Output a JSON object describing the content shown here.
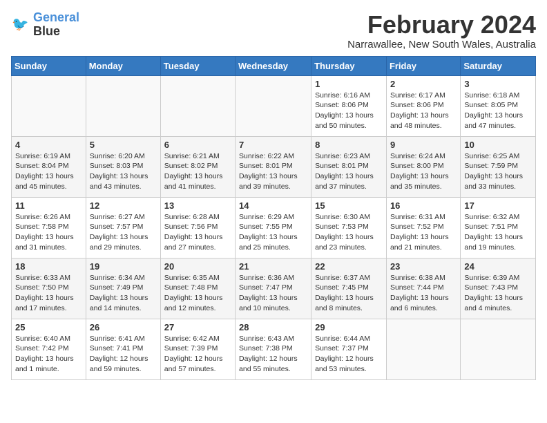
{
  "header": {
    "logo_line1": "General",
    "logo_line2": "Blue",
    "month_year": "February 2024",
    "location": "Narrawallee, New South Wales, Australia"
  },
  "days_of_week": [
    "Sunday",
    "Monday",
    "Tuesday",
    "Wednesday",
    "Thursday",
    "Friday",
    "Saturday"
  ],
  "weeks": [
    [
      {
        "day": "",
        "info": ""
      },
      {
        "day": "",
        "info": ""
      },
      {
        "day": "",
        "info": ""
      },
      {
        "day": "",
        "info": ""
      },
      {
        "day": "1",
        "info": "Sunrise: 6:16 AM\nSunset: 8:06 PM\nDaylight: 13 hours\nand 50 minutes."
      },
      {
        "day": "2",
        "info": "Sunrise: 6:17 AM\nSunset: 8:06 PM\nDaylight: 13 hours\nand 48 minutes."
      },
      {
        "day": "3",
        "info": "Sunrise: 6:18 AM\nSunset: 8:05 PM\nDaylight: 13 hours\nand 47 minutes."
      }
    ],
    [
      {
        "day": "4",
        "info": "Sunrise: 6:19 AM\nSunset: 8:04 PM\nDaylight: 13 hours\nand 45 minutes."
      },
      {
        "day": "5",
        "info": "Sunrise: 6:20 AM\nSunset: 8:03 PM\nDaylight: 13 hours\nand 43 minutes."
      },
      {
        "day": "6",
        "info": "Sunrise: 6:21 AM\nSunset: 8:02 PM\nDaylight: 13 hours\nand 41 minutes."
      },
      {
        "day": "7",
        "info": "Sunrise: 6:22 AM\nSunset: 8:01 PM\nDaylight: 13 hours\nand 39 minutes."
      },
      {
        "day": "8",
        "info": "Sunrise: 6:23 AM\nSunset: 8:01 PM\nDaylight: 13 hours\nand 37 minutes."
      },
      {
        "day": "9",
        "info": "Sunrise: 6:24 AM\nSunset: 8:00 PM\nDaylight: 13 hours\nand 35 minutes."
      },
      {
        "day": "10",
        "info": "Sunrise: 6:25 AM\nSunset: 7:59 PM\nDaylight: 13 hours\nand 33 minutes."
      }
    ],
    [
      {
        "day": "11",
        "info": "Sunrise: 6:26 AM\nSunset: 7:58 PM\nDaylight: 13 hours\nand 31 minutes."
      },
      {
        "day": "12",
        "info": "Sunrise: 6:27 AM\nSunset: 7:57 PM\nDaylight: 13 hours\nand 29 minutes."
      },
      {
        "day": "13",
        "info": "Sunrise: 6:28 AM\nSunset: 7:56 PM\nDaylight: 13 hours\nand 27 minutes."
      },
      {
        "day": "14",
        "info": "Sunrise: 6:29 AM\nSunset: 7:55 PM\nDaylight: 13 hours\nand 25 minutes."
      },
      {
        "day": "15",
        "info": "Sunrise: 6:30 AM\nSunset: 7:53 PM\nDaylight: 13 hours\nand 23 minutes."
      },
      {
        "day": "16",
        "info": "Sunrise: 6:31 AM\nSunset: 7:52 PM\nDaylight: 13 hours\nand 21 minutes."
      },
      {
        "day": "17",
        "info": "Sunrise: 6:32 AM\nSunset: 7:51 PM\nDaylight: 13 hours\nand 19 minutes."
      }
    ],
    [
      {
        "day": "18",
        "info": "Sunrise: 6:33 AM\nSunset: 7:50 PM\nDaylight: 13 hours\nand 17 minutes."
      },
      {
        "day": "19",
        "info": "Sunrise: 6:34 AM\nSunset: 7:49 PM\nDaylight: 13 hours\nand 14 minutes."
      },
      {
        "day": "20",
        "info": "Sunrise: 6:35 AM\nSunset: 7:48 PM\nDaylight: 13 hours\nand 12 minutes."
      },
      {
        "day": "21",
        "info": "Sunrise: 6:36 AM\nSunset: 7:47 PM\nDaylight: 13 hours\nand 10 minutes."
      },
      {
        "day": "22",
        "info": "Sunrise: 6:37 AM\nSunset: 7:45 PM\nDaylight: 13 hours\nand 8 minutes."
      },
      {
        "day": "23",
        "info": "Sunrise: 6:38 AM\nSunset: 7:44 PM\nDaylight: 13 hours\nand 6 minutes."
      },
      {
        "day": "24",
        "info": "Sunrise: 6:39 AM\nSunset: 7:43 PM\nDaylight: 13 hours\nand 4 minutes."
      }
    ],
    [
      {
        "day": "25",
        "info": "Sunrise: 6:40 AM\nSunset: 7:42 PM\nDaylight: 13 hours\nand 1 minute."
      },
      {
        "day": "26",
        "info": "Sunrise: 6:41 AM\nSunset: 7:41 PM\nDaylight: 12 hours\nand 59 minutes."
      },
      {
        "day": "27",
        "info": "Sunrise: 6:42 AM\nSunset: 7:39 PM\nDaylight: 12 hours\nand 57 minutes."
      },
      {
        "day": "28",
        "info": "Sunrise: 6:43 AM\nSunset: 7:38 PM\nDaylight: 12 hours\nand 55 minutes."
      },
      {
        "day": "29",
        "info": "Sunrise: 6:44 AM\nSunset: 7:37 PM\nDaylight: 12 hours\nand 53 minutes."
      },
      {
        "day": "",
        "info": ""
      },
      {
        "day": "",
        "info": ""
      }
    ]
  ]
}
